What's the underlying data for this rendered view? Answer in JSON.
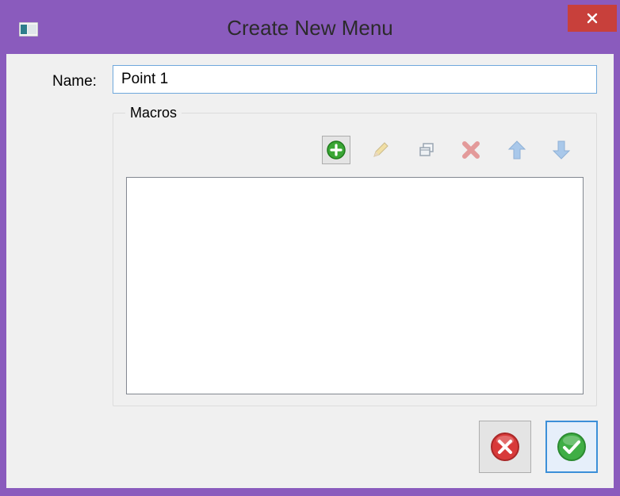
{
  "window": {
    "title": "Create New Menu",
    "app_icon": "window-app-icon",
    "close_icon": "close-icon"
  },
  "form": {
    "name_label": "Name:",
    "name_value": "Point 1"
  },
  "macros": {
    "group_title": "Macros",
    "toolbar": [
      {
        "icon": "add-icon",
        "enabled": true
      },
      {
        "icon": "edit-pencil-icon",
        "enabled": false
      },
      {
        "icon": "duplicate-icon",
        "enabled": false
      },
      {
        "icon": "delete-icon",
        "enabled": false
      },
      {
        "icon": "move-up-icon",
        "enabled": false
      },
      {
        "icon": "move-down-icon",
        "enabled": false
      }
    ],
    "items": []
  },
  "buttons": {
    "cancel_icon": "cancel-icon",
    "ok_icon": "ok-check-icon"
  },
  "colors": {
    "window_frame": "#8a5bbd",
    "close_button": "#c8403b",
    "input_border_focus": "#6fa8dc"
  }
}
